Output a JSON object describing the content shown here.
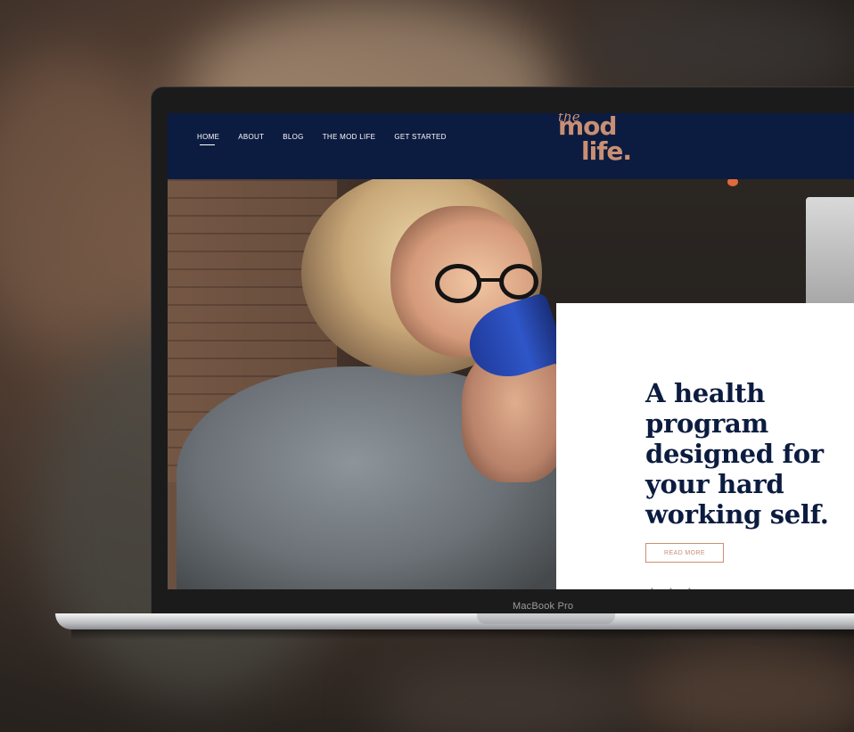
{
  "device": {
    "label": "MacBook Pro"
  },
  "nav": {
    "items": [
      {
        "label": "HOME",
        "active": true
      },
      {
        "label": "ABOUT",
        "active": false
      },
      {
        "label": "BLOG",
        "active": false
      },
      {
        "label": "THE MOD LIFE",
        "active": false
      },
      {
        "label": "GET STARTED",
        "active": false
      }
    ]
  },
  "logo": {
    "line1": "the",
    "line2": "mod",
    "line3": "life."
  },
  "hero": {
    "headline": "A health program designed for your hard working self.",
    "cta_label": "READ MORE"
  },
  "colors": {
    "nav_bg": "#0c1c40",
    "accent": "#c98f74",
    "headline": "#0c1c40"
  }
}
